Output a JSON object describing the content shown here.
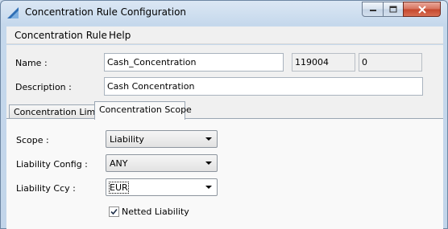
{
  "window": {
    "title": "Concentration Rule Configuration"
  },
  "menu": {
    "items": [
      "Concentration Rule",
      "Help"
    ]
  },
  "form": {
    "name_label": "Name :",
    "name_value": "Cash_Concentration",
    "id_value": "119004",
    "version_value": "0",
    "description_label": "Description :",
    "description_value": "Cash Concentration"
  },
  "tabs": [
    {
      "label": "Concentration Limits",
      "active": false
    },
    {
      "label": "Concentration Scope",
      "active": true
    }
  ],
  "scope_panel": {
    "scope_label": "Scope :",
    "scope_value": "Liability",
    "liability_config_label": "Liability Config :",
    "liability_config_value": "ANY",
    "liability_ccy_label": "Liability Ccy :",
    "liability_ccy_value": "EUR",
    "netted_liability_label": "Netted Liability",
    "netted_liability_checked": true
  }
}
